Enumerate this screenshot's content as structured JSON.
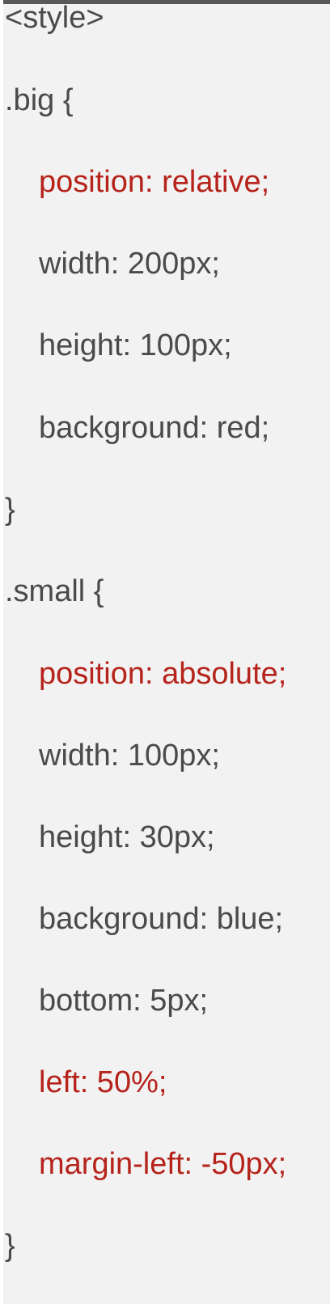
{
  "code": {
    "lines": [
      "<style>",
      ".big {",
      "position: relative;",
      "width: 200px;",
      "height: 100px;",
      "background: red;",
      "}",
      ".small {",
      "position: absolute;",
      "width: 100px;",
      "height: 30px;",
      "background: blue;",
      "bottom: 5px;",
      "left: 50%;",
      "margin-left: -50px;",
      "}"
    ]
  },
  "colors": {
    "text": "#4a4a4a",
    "highlight": "#b5231b",
    "background": "#f2f2f2",
    "top_border": "#595959"
  }
}
